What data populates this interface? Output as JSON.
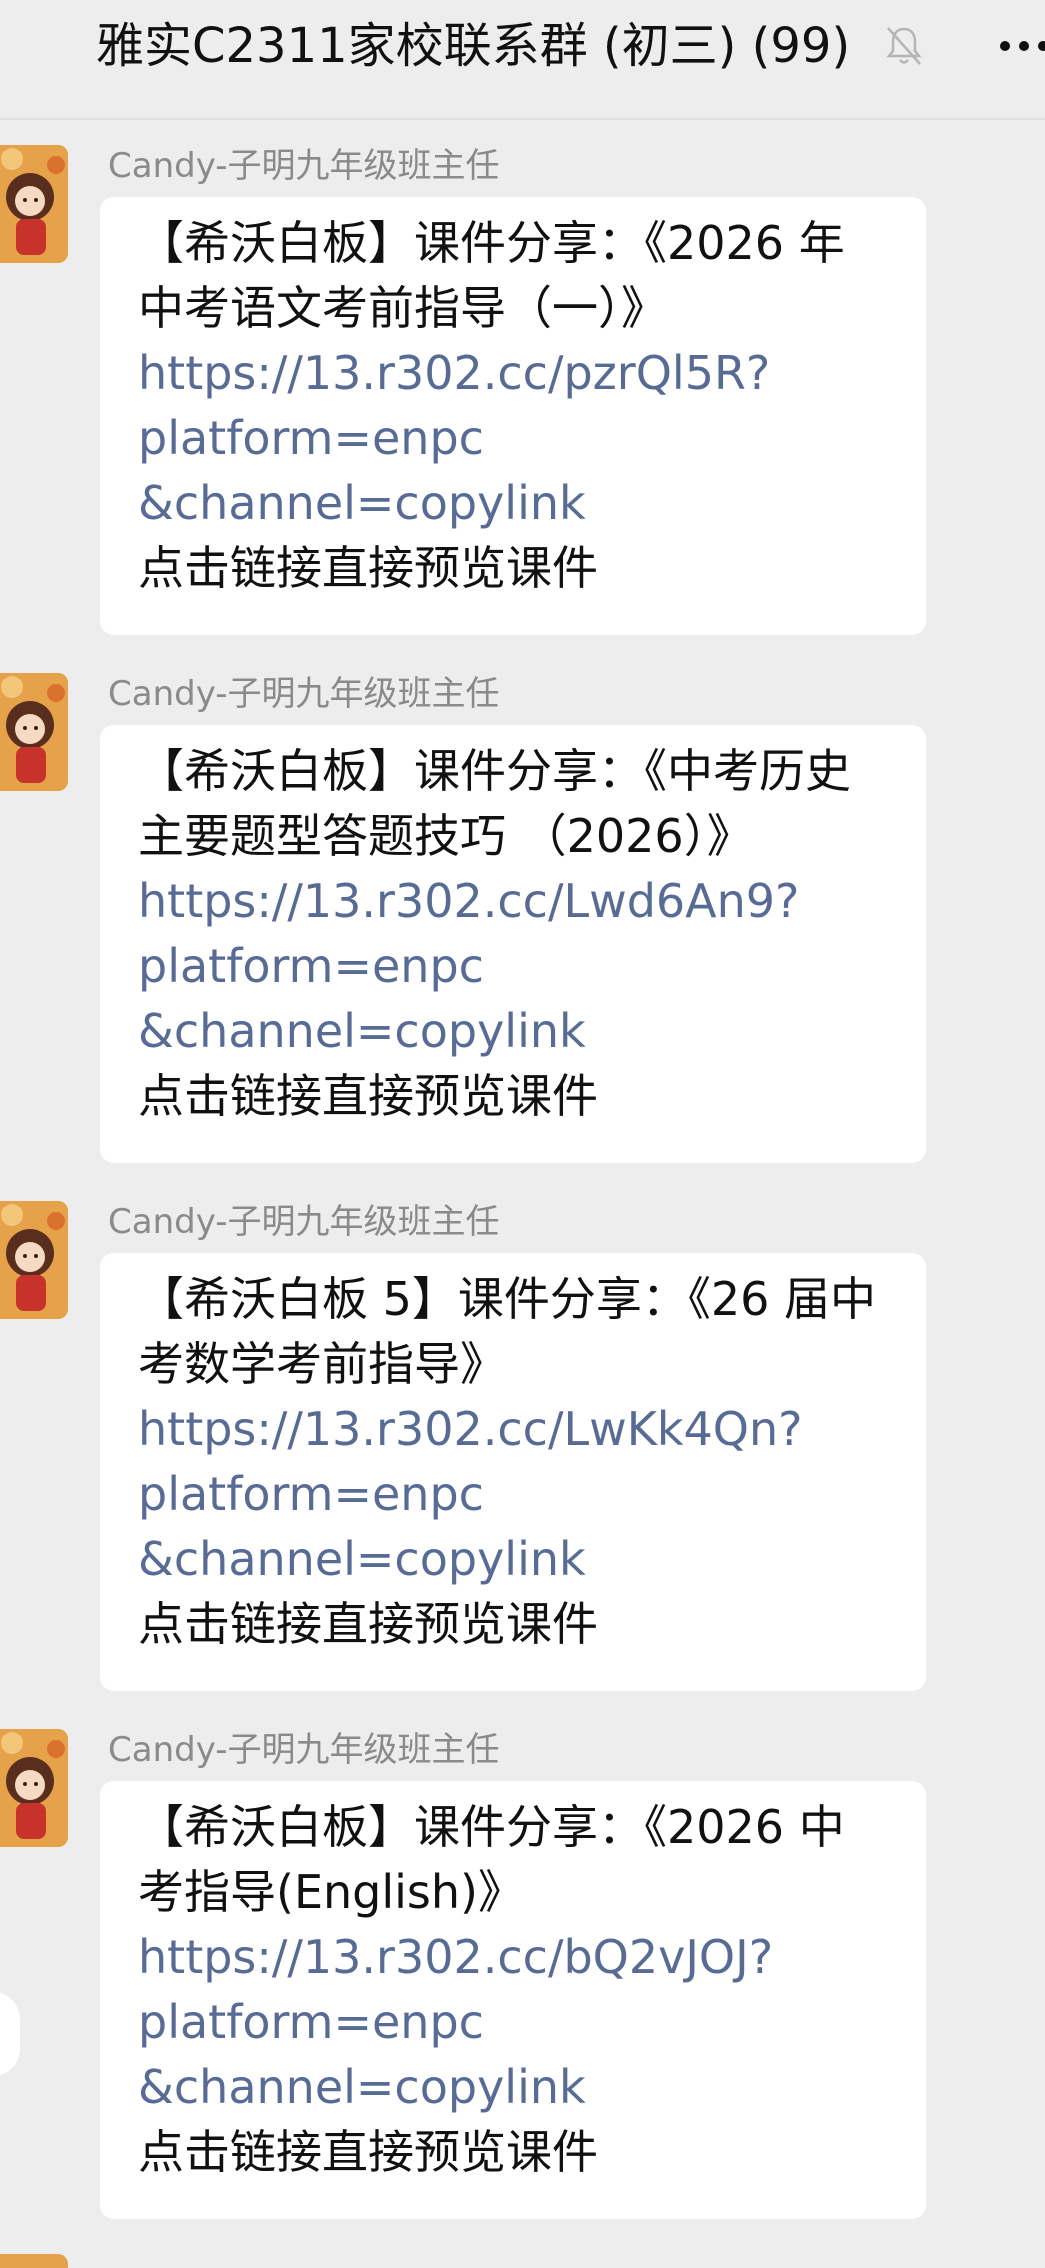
{
  "header": {
    "title": "雅实C2311家校联系群 (初三) (99)",
    "mute_icon": "bell-off-icon",
    "more_icon": "more-dots-icon"
  },
  "colors": {
    "background": "#ededed",
    "bubble": "#ffffff",
    "link": "#576b95",
    "sender": "#8a8a8a",
    "text": "#111111"
  },
  "messages": [
    {
      "sender": "Candy-子明九年级班主任",
      "title_line1": "【希沃白板】课件分享：《2026 年",
      "title_line2": "中考语文考前指导（一）》",
      "link_line1": "https://13.r302.cc/pzrQl5R?",
      "link_line2": "platform=enpc",
      "link_line3": "&channel=copylink",
      "footer": "点击链接直接预览课件"
    },
    {
      "sender": "Candy-子明九年级班主任",
      "title_line1": "【希沃白板】课件分享：《中考历史",
      "title_line2": "主要题型答题技巧 （2026）》",
      "link_line1": "https://13.r302.cc/Lwd6An9?",
      "link_line2": "platform=enpc",
      "link_line3": "&channel=copylink",
      "footer": "点击链接直接预览课件"
    },
    {
      "sender": "Candy-子明九年级班主任",
      "title_line1": "【希沃白板 5】课件分享：《26 届中",
      "title_line2": "考数学考前指导》",
      "link_line1": "https://13.r302.cc/LwKk4Qn?",
      "link_line2": "platform=enpc",
      "link_line3": "&channel=copylink",
      "footer": "点击链接直接预览课件"
    },
    {
      "sender": "Candy-子明九年级班主任",
      "title_line1": "【希沃白板】课件分享：《2026 中",
      "title_line2": "考指导(English)》",
      "link_line1": "https://13.r302.cc/bQ2vJOJ?",
      "link_line2": "platform=enpc",
      "link_line3": "&channel=copylink",
      "footer": "点击链接直接预览课件"
    }
  ]
}
